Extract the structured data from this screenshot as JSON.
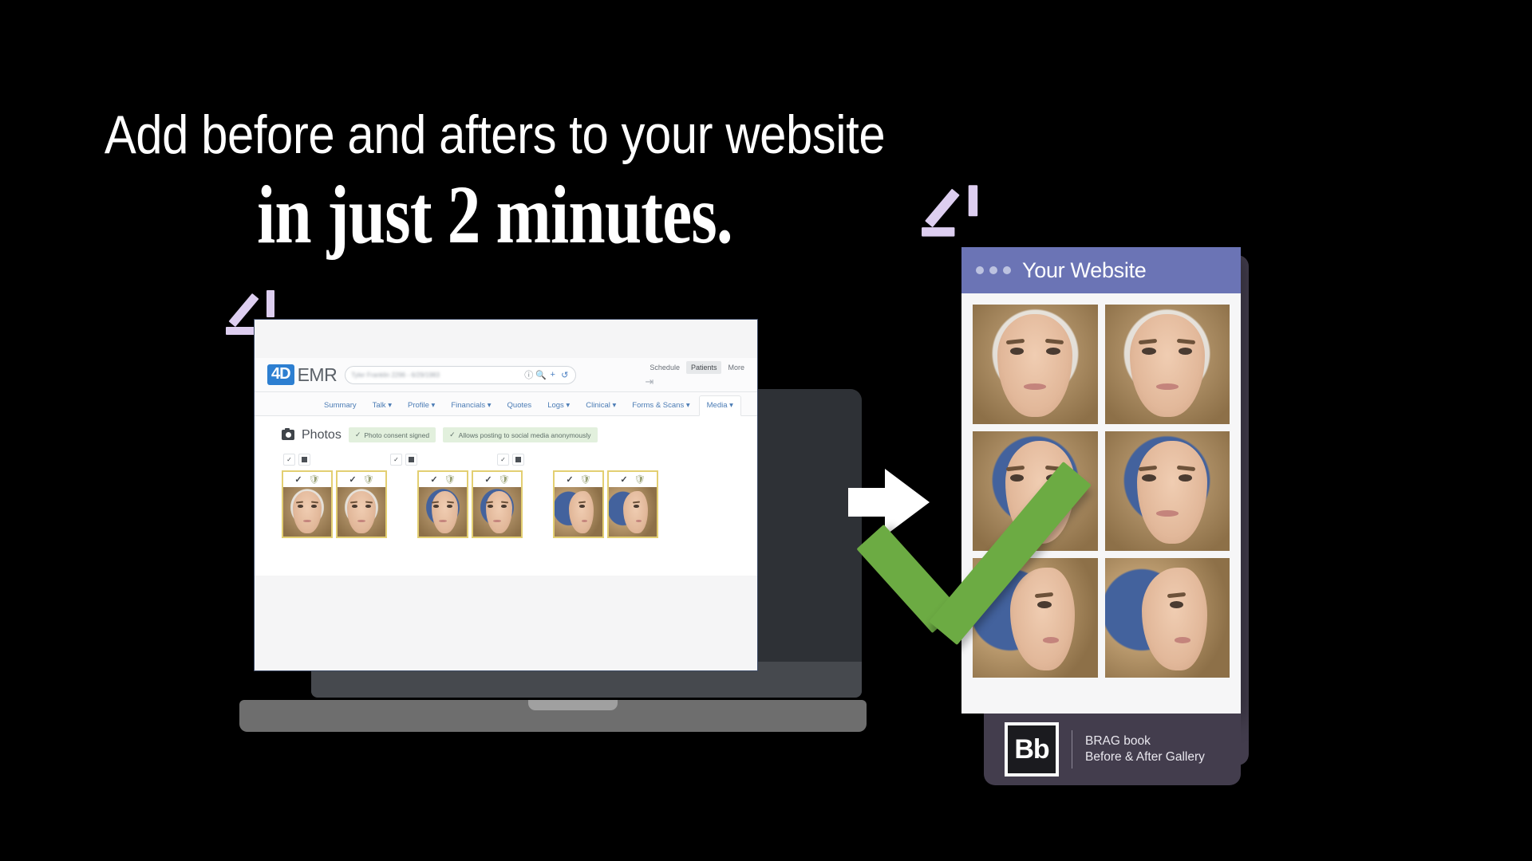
{
  "headline": {
    "line1": "Add before and afters to your website",
    "line2": "in just 2 minutes."
  },
  "colors": {
    "background": "#000000",
    "accent_green": "#6cab43",
    "website_header": "#6b74b5",
    "sparkle": "#ddcef0",
    "emr_logo_blue": "#2d7fd1",
    "thumb_border_gold": "#e3cf72",
    "panel_dark": "#433d4d"
  },
  "emr": {
    "logo_mark": "4D",
    "logo_text": "EMR",
    "search": {
      "value": "Tyler Franklin 2296  -  6/29/1983",
      "clear_icon": "clear-circle-icon",
      "search_icon": "search-icon",
      "add_icon": "plus-icon",
      "history_icon": "history-icon"
    },
    "nav": [
      {
        "label": "Schedule",
        "active": false
      },
      {
        "label": "Patients",
        "active": true
      },
      {
        "label": "More",
        "active": false
      }
    ],
    "logout_icon": "logout-icon",
    "tabs": [
      {
        "label": "Summary",
        "caret": false,
        "selected": false
      },
      {
        "label": "Talk",
        "caret": true,
        "selected": false
      },
      {
        "label": "Profile",
        "caret": true,
        "selected": false
      },
      {
        "label": "Financials",
        "caret": true,
        "selected": false
      },
      {
        "label": "Quotes",
        "caret": false,
        "selected": false
      },
      {
        "label": "Logs",
        "caret": true,
        "selected": false
      },
      {
        "label": "Clinical",
        "caret": true,
        "selected": false
      },
      {
        "label": "Forms & Scans",
        "caret": true,
        "selected": false
      },
      {
        "label": "Media",
        "caret": true,
        "selected": true
      }
    ],
    "photos_section": {
      "title": "Photos",
      "camera_icon": "camera-icon",
      "badges": [
        {
          "icon": "check-circle-icon",
          "label": "Photo consent signed"
        },
        {
          "icon": "check-circle-icon",
          "label": "Allows posting to social media anonymously"
        }
      ],
      "toggle_groups": [
        {
          "check_icon": "checkbox-checked-icon",
          "square_icon": "filled-square-icon"
        },
        {
          "check_icon": "checkbox-checked-icon",
          "square_icon": "filled-square-icon"
        },
        {
          "check_icon": "checkbox-checked-icon",
          "square_icon": "filled-square-icon"
        }
      ],
      "thumbnails": [
        {
          "view": "front",
          "bg": "white",
          "check_icon": "check-icon",
          "shield_icon": "shield-check-icon",
          "selected": true
        },
        {
          "view": "front",
          "bg": "white",
          "check_icon": "check-icon",
          "shield_icon": "shield-check-icon",
          "selected": true
        },
        {
          "view": "oblique",
          "bg": "blue",
          "check_icon": "check-icon",
          "shield_icon": "shield-check-icon",
          "selected": true
        },
        {
          "view": "oblique",
          "bg": "blue",
          "check_icon": "check-icon",
          "shield_icon": "shield-check-icon",
          "selected": true
        },
        {
          "view": "profile",
          "bg": "blue",
          "check_icon": "check-icon",
          "shield_icon": "shield-check-icon",
          "selected": true
        },
        {
          "view": "profile",
          "bg": "blue",
          "check_icon": "check-icon",
          "shield_icon": "shield-check-icon",
          "selected": true
        }
      ]
    }
  },
  "arrow": {
    "icon": "arrow-right-icon"
  },
  "website": {
    "title": "Your Website",
    "dots_icon": "window-dots-icon",
    "gallery": [
      {
        "view": "front",
        "bg": "white"
      },
      {
        "view": "front",
        "bg": "white"
      },
      {
        "view": "oblique",
        "bg": "blue"
      },
      {
        "view": "oblique",
        "bg": "blue"
      },
      {
        "view": "profile",
        "bg": "blue"
      },
      {
        "view": "profile",
        "bg": "blue"
      }
    ],
    "footer": {
      "logo_text": "Bb",
      "brand_line1": "BRAG book",
      "brand_line2": "Before & After Gallery"
    }
  },
  "green_check": {
    "icon": "check-mark-icon"
  },
  "sparkles": [
    {
      "name": "sparkle-laptop"
    },
    {
      "name": "sparkle-website"
    }
  ]
}
